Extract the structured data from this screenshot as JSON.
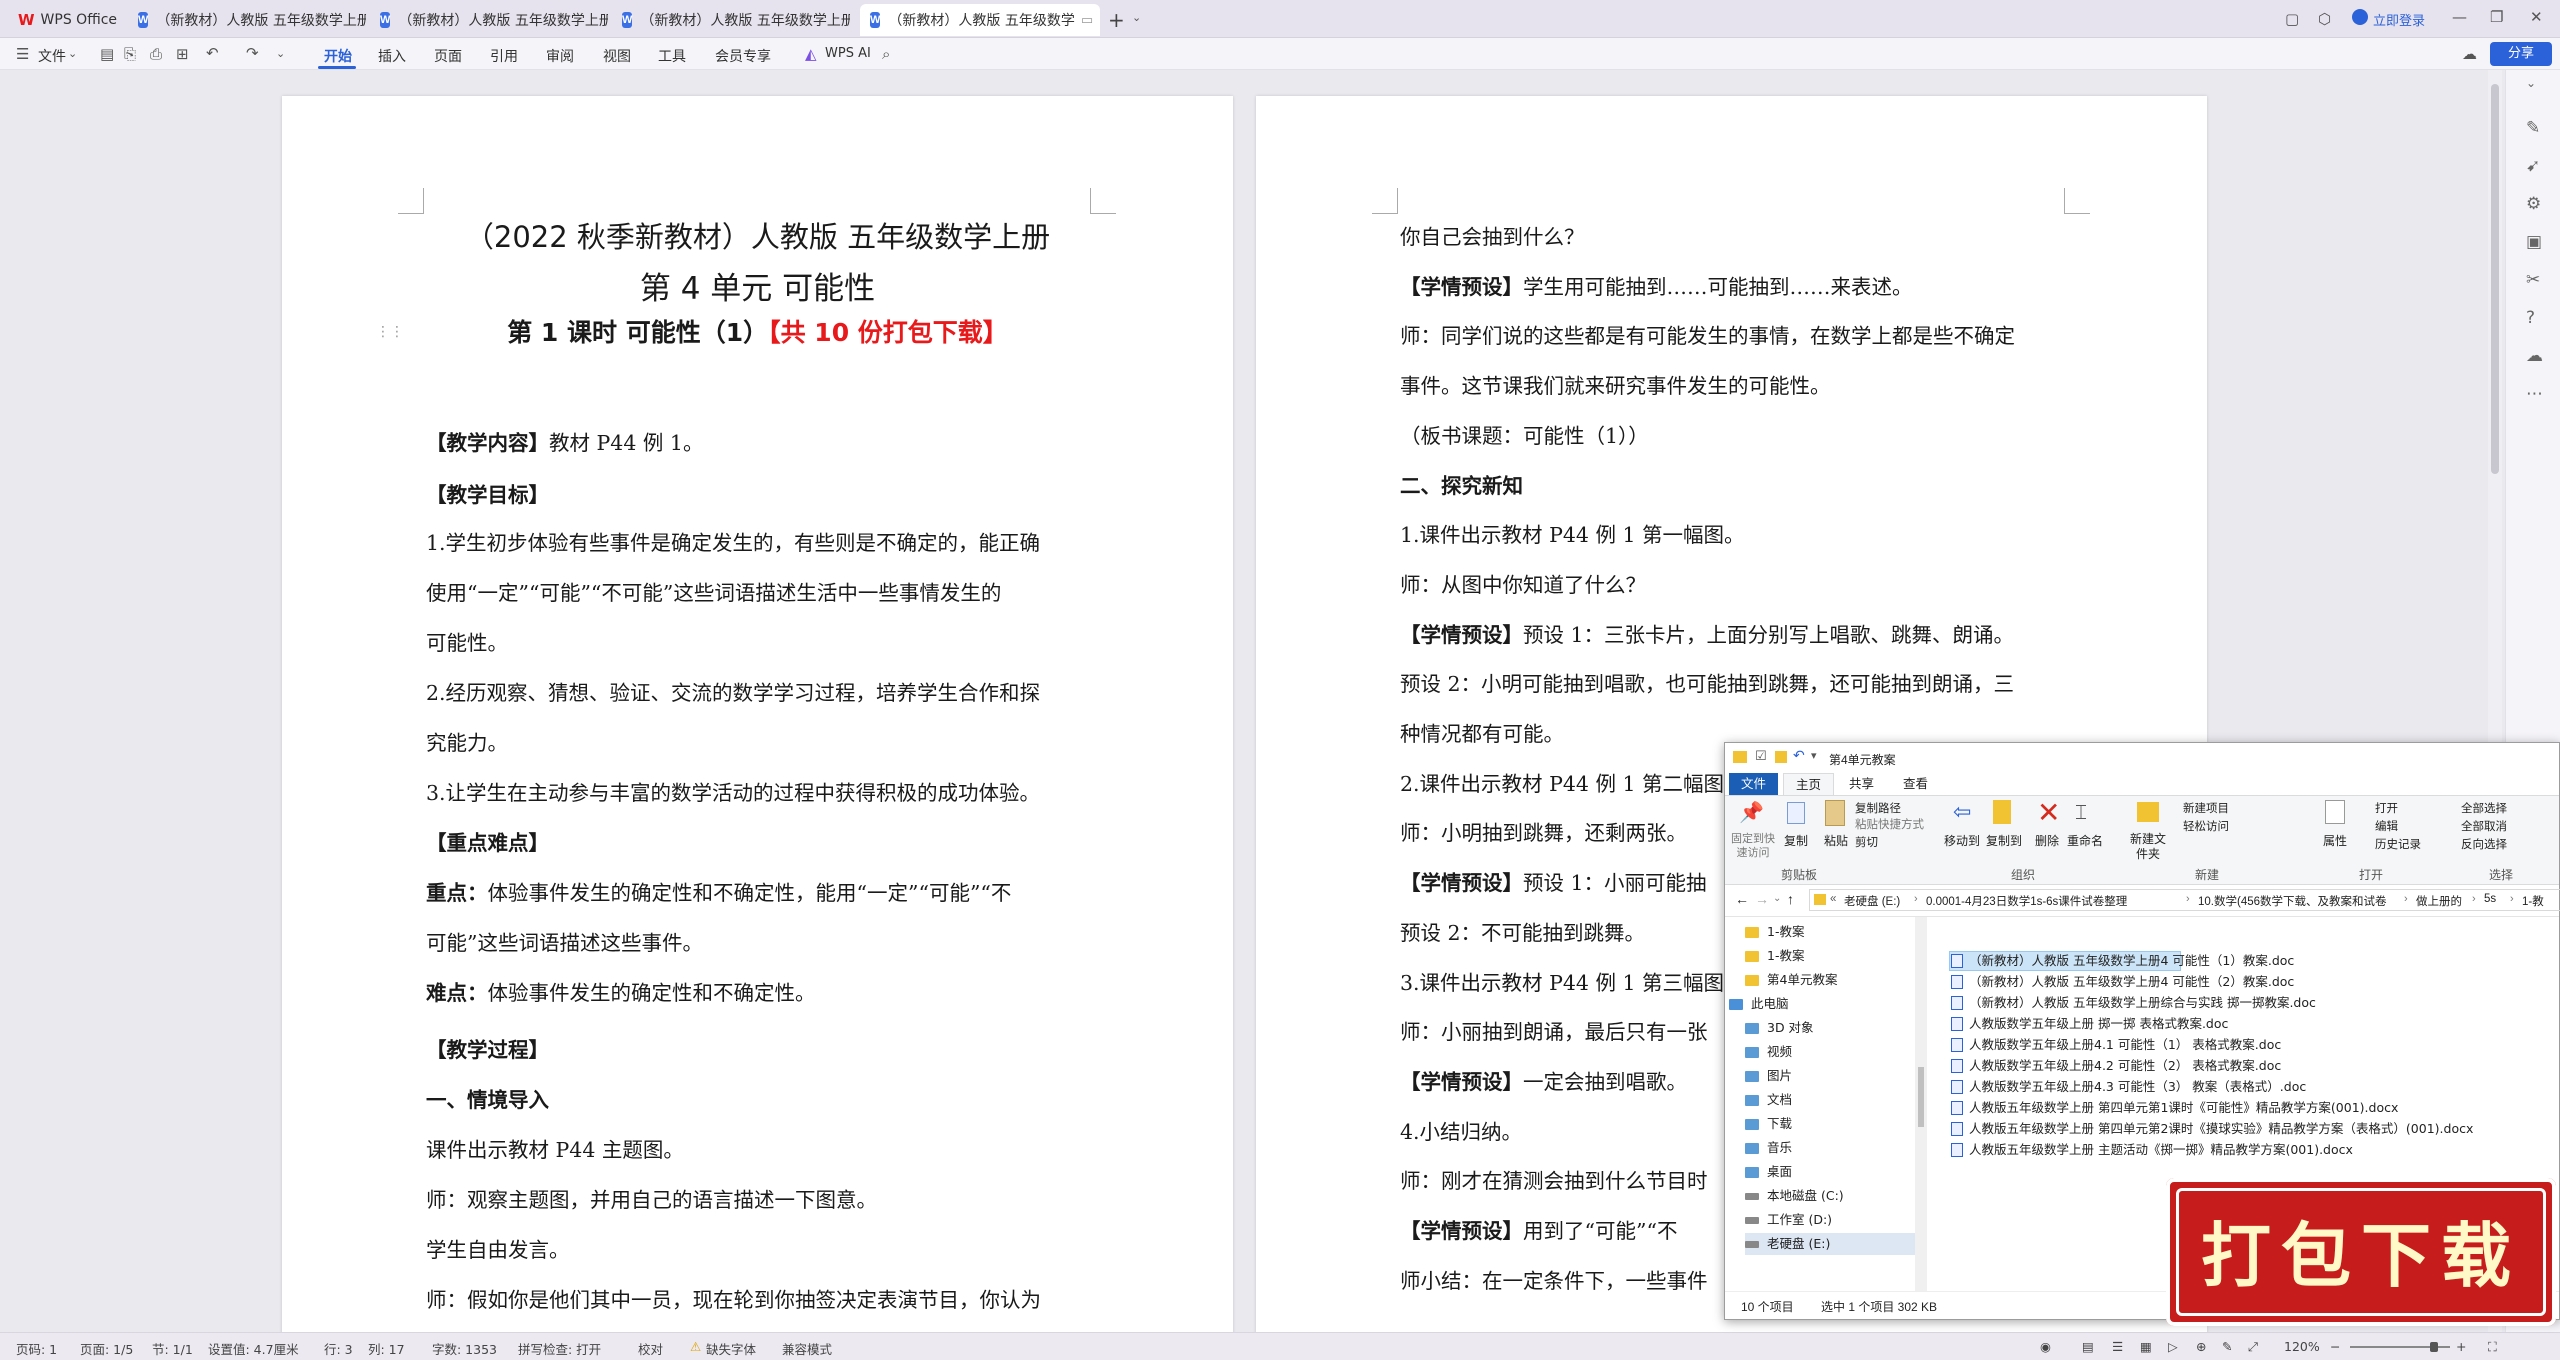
{
  "tabs": [
    {
      "label": "WPS Office"
    },
    {
      "label": "（新教材）人教版 五年级数学上册"
    },
    {
      "label": "（新教材）人教版 五年级数学上册"
    },
    {
      "label": "（新教材）人教版 五年级数学上册"
    },
    {
      "label": "（新教材）人教版 五年级数学"
    }
  ],
  "topright": {
    "login": "立即登录"
  },
  "ribbon": {
    "file": "文件",
    "items": [
      "开始",
      "插入",
      "页面",
      "引用",
      "审阅",
      "视图",
      "工具",
      "会员专享"
    ],
    "wps_ai": "WPS AI",
    "share": "分享"
  },
  "page1": {
    "title1": "（2022 秋季新教材）人教版 五年级数学上册",
    "title2": "第 4 单元      可能性",
    "title3a": "第 1 课时    可能性（1）",
    "title3b": "【共 10 份打包下载】",
    "lines": [
      {
        "bold": "【教学内容】",
        "text": "教材 P44 例 1。"
      },
      {
        "bold": "【教学目标】",
        "text": ""
      },
      {
        "bold": "",
        "text": "1.学生初步体验有些事件是确定发生的，有些则是不确定的，能正确"
      },
      {
        "bold": "",
        "text": "使用“一定”“可能”“不可能”这些词语描述生活中一些事情发生的"
      },
      {
        "bold": "",
        "text": "可能性。"
      },
      {
        "bold": "",
        "text": "2.经历观察、猜想、验证、交流的数学学习过程，培养学生合作和探"
      },
      {
        "bold": "",
        "text": "究能力。"
      },
      {
        "bold": "",
        "text": "3.让学生在主动参与丰富的数学活动的过程中获得积极的成功体验。"
      },
      {
        "bold": "【重点难点】",
        "text": ""
      },
      {
        "bold": "重点：",
        "text": "体验事件发生的确定性和不确定性，能用“一定”“可能”“不"
      },
      {
        "bold": "",
        "text": "可能”这些词语描述这些事件。"
      },
      {
        "bold": "难点：",
        "text": "体验事件发生的确定性和不确定性。"
      },
      {
        "bold": "【教学过程】",
        "text": ""
      },
      {
        "bold": "一、情境导入",
        "text": ""
      },
      {
        "bold": "",
        "text": "课件出示教材 P44 主题图。"
      },
      {
        "bold": "",
        "text": "师：观察主题图，并用自己的语言描述一下图意。"
      },
      {
        "bold": "",
        "text": "学生自由发言。"
      },
      {
        "bold": "",
        "text": "师：假如你是他们其中一员，现在轮到你抽签决定表演节目，你认为"
      }
    ]
  },
  "page2": {
    "lines": [
      {
        "bold": "",
        "text": "你自己会抽到什么？"
      },
      {
        "bold": "【学情预设】",
        "text": "学生用可能抽到……可能抽到……来表述。"
      },
      {
        "bold": "",
        "text": "师：同学们说的这些都是有可能发生的事情，在数学上都是些不确定"
      },
      {
        "bold": "",
        "text": "事件。这节课我们就来研究事件发生的可能性。"
      },
      {
        "bold": "",
        "text": "（板书课题：可能性（1））"
      },
      {
        "bold": "二、探究新知",
        "text": ""
      },
      {
        "bold": "",
        "text": "1.课件出示教材 P44 例 1 第一幅图。"
      },
      {
        "bold": "",
        "text": "师：从图中你知道了什么？"
      },
      {
        "bold": "【学情预设】",
        "text": "预设 1：三张卡片，上面分别写上唱歌、跳舞、朗诵。"
      },
      {
        "bold": "",
        "text": "预设 2：小明可能抽到唱歌，也可能抽到跳舞，还可能抽到朗诵，三"
      },
      {
        "bold": "",
        "text": "种情况都有可能。"
      },
      {
        "bold": "",
        "text": "2.课件出示教材 P44 例 1 第二幅图"
      },
      {
        "bold": "",
        "text": "师：小明抽到跳舞，还剩两张。"
      },
      {
        "bold": "【学情预设】",
        "text": "预设 1：小丽可能抽"
      },
      {
        "bold": "",
        "text": "预设 2：不可能抽到跳舞。"
      },
      {
        "bold": "",
        "text": "3.课件出示教材 P44 例 1 第三幅图"
      },
      {
        "bold": "",
        "text": "师：小丽抽到朗诵，最后只有一张"
      },
      {
        "bold": "【学情预设】",
        "text": "一定会抽到唱歌。"
      },
      {
        "bold": "",
        "text": "4.小结归纳。"
      },
      {
        "bold": "",
        "text": "师：刚才在猜测会抽到什么节目时"
      },
      {
        "bold": "【学情预设】",
        "text": "用到了“可能”“不"
      },
      {
        "bold": "",
        "text": "师小结：在一定条件下，一些事件"
      }
    ]
  },
  "status": {
    "page": "页码: 1",
    "pages": "页面: 1/5",
    "section": "节: 1/1",
    "setting": "设置值: 4.7厘米",
    "row": "行: 3",
    "col": "列: 17",
    "words": "字数: 1353",
    "spell": "拼写检查: 打开",
    "proof": "校对",
    "font": "缺失字体",
    "compat": "兼容模式",
    "zoom": "120%"
  },
  "explorer": {
    "title": "第4单元教案",
    "tabs": [
      "文件",
      "主页",
      "共享",
      "查看"
    ],
    "ribbon": {
      "pin": "固定到快速访问",
      "copy": "复制",
      "paste": "粘贴",
      "copy_path": "复制路径",
      "paste_shortcut": "粘贴快捷方式",
      "cut": "剪切",
      "clipboard": "剪贴板",
      "move_to": "移动到",
      "copy_to": "复制到",
      "delete": "删除",
      "rename": "重命名",
      "organize": "组织",
      "new_folder": "新建文件夹",
      "new_item": "新建项目",
      "easy_access": "轻松访问",
      "new": "新建",
      "properties": "属性",
      "open": "打开",
      "edit": "编辑",
      "history": "历史记录",
      "open_group": "打开",
      "select_all": "全部选择",
      "select_none": "全部取消",
      "invert": "反向选择",
      "select": "选择"
    },
    "address": [
      "老硬盘 (E:)",
      "0.0001-4月23日数学1s-6s课件试卷整理",
      "10.数学(456数学下载、及教案和试卷",
      "做上册的",
      "5s",
      "1-教"
    ],
    "nav": [
      {
        "label": "1-教案",
        "type": "folder"
      },
      {
        "label": "1-教案",
        "type": "folder"
      },
      {
        "label": "第4单元教案",
        "type": "folder"
      },
      {
        "label": "此电脑",
        "type": "pc"
      },
      {
        "label": "3D 对象",
        "type": "item"
      },
      {
        "label": "视频",
        "type": "item"
      },
      {
        "label": "图片",
        "type": "item"
      },
      {
        "label": "文档",
        "type": "item"
      },
      {
        "label": "下载",
        "type": "item"
      },
      {
        "label": "音乐",
        "type": "item"
      },
      {
        "label": "桌面",
        "type": "item"
      },
      {
        "label": "本地磁盘 (C:)",
        "type": "drive"
      },
      {
        "label": "工作室 (D:)",
        "type": "drive"
      },
      {
        "label": "老硬盘 (E:)",
        "type": "drive"
      }
    ],
    "files": [
      "（新教材）人教版 五年级数学上册4  可能性（1）教案.doc",
      "（新教材）人教版 五年级数学上册4  可能性（2）教案.doc",
      "（新教材）人教版 五年级数学上册综合与实践 掷一掷教案.doc",
      "人教版数学五年级上册 掷一掷 表格式教案.doc",
      "人教版数学五年级上册4.1 可能性（1） 表格式教案.doc",
      "人教版数学五年级上册4.2 可能性（2） 表格式教案.doc",
      "人教版数学五年级上册4.3 可能性（3） 教案（表格式）.doc",
      "人教版五年级数学上册 第四单元第1课时《可能性》精品教学方案(001).docx",
      "人教版五年级数学上册 第四单元第2课时《摸球实验》精品教学方案（表格式）(001).docx",
      "人教版五年级数学上册 主题活动《掷一掷》精品教学方案(001).docx"
    ],
    "status_items": "10 个项目",
    "status_selected": "选中 1 个项目  302 KB"
  },
  "stamp": {
    "text": "打包下载"
  }
}
